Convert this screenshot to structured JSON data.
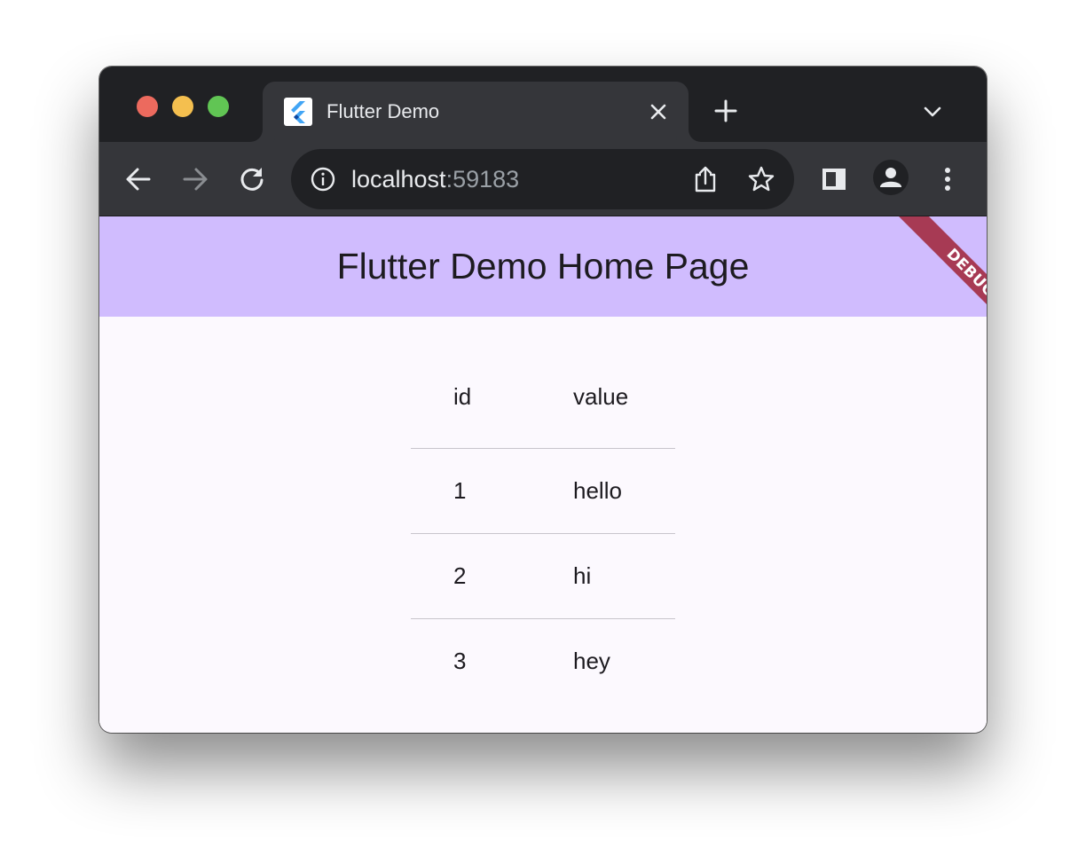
{
  "browser": {
    "tab": {
      "title": "Flutter Demo"
    },
    "omnibox": {
      "host": "localhost",
      "port": ":59183"
    },
    "colors": {
      "tabstrip": "#202124",
      "toolbar": "#35363a",
      "omnibox": "#202124"
    }
  },
  "app": {
    "title": "Flutter Demo Home Page",
    "debug_label": "DEBUG",
    "colors": {
      "appbar": "#d0bcfe",
      "background": "#fcf9fe",
      "divider": "#c8c5cc"
    },
    "table": {
      "headers": [
        "id",
        "value"
      ],
      "rows": [
        [
          "1",
          "hello"
        ],
        [
          "2",
          "hi"
        ],
        [
          "3",
          "hey"
        ]
      ]
    }
  },
  "icons": {
    "tab_favicon": "flutter-logo-icon",
    "tab_close": "close-icon",
    "new_tab": "plus-icon",
    "tab_search": "chevron-down-icon",
    "back": "arrow-left-icon",
    "forward": "arrow-right-icon",
    "reload": "reload-icon",
    "site_info": "info-icon",
    "share": "share-icon",
    "bookmark": "star-icon",
    "side_panel": "side-panel-icon",
    "profile": "avatar-icon",
    "menu": "kebab-menu-icon"
  }
}
